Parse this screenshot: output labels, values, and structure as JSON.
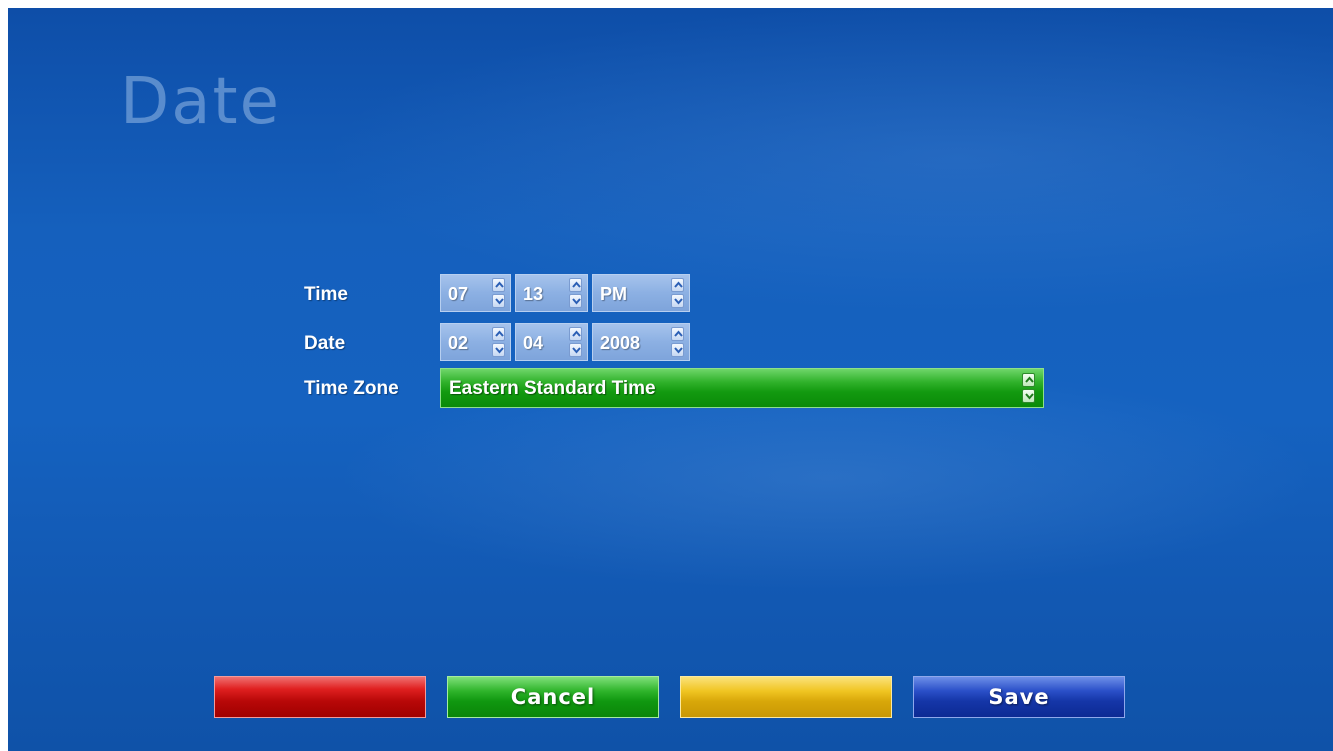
{
  "page": {
    "title": "Date"
  },
  "colors": {
    "background": "#1560bd",
    "spinner": "#8cb0e3",
    "selected_field": "#139a10",
    "red_button": "#b80808",
    "green_button": "#109810",
    "yellow_button": "#d9a80a",
    "blue_button": "#1536a8"
  },
  "form": {
    "time": {
      "label": "Time",
      "hour": "07",
      "minute": "13",
      "ampm": "PM"
    },
    "date": {
      "label": "Date",
      "month": "02",
      "day": "04",
      "year": "2008"
    },
    "timezone": {
      "label": "Time Zone",
      "value": "Eastern Standard Time"
    }
  },
  "icons": {
    "up": "chevron-up-icon",
    "down": "chevron-down-icon"
  },
  "buttons": {
    "red_label": "",
    "cancel_label": "Cancel",
    "yellow_label": "",
    "save_label": "Save"
  }
}
